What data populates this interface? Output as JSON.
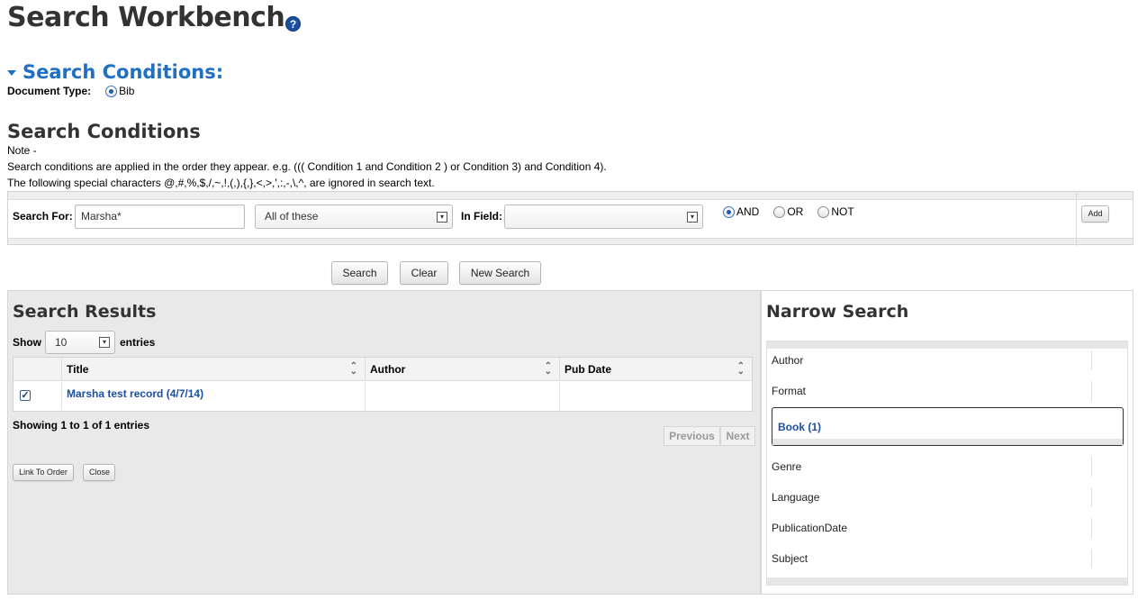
{
  "header": {
    "title": "Search Workbench",
    "help_glyph": "?"
  },
  "section": {
    "title": "Search Conditions:"
  },
  "document_type": {
    "label": "Document Type:",
    "option": "Bib"
  },
  "conditions": {
    "heading": "Search Conditions",
    "note_label": "Note -",
    "note_line1": "Search conditions are applied in the order they appear. e.g. ((( Condition 1 and Condition 2 ) or Condition 3) and Condition 4).",
    "note_line2": "The following special characters @,#,%,$,/,~,!,(,),{,},<,>,',:,-,\\,^, are ignored in search text.",
    "search_for_label": "Search For:",
    "search_for_value": "Marsha*",
    "match_select": "All of these",
    "in_field_label": "In Field:",
    "in_field_value": "",
    "operators": [
      "AND",
      "OR",
      "NOT"
    ],
    "selected_operator": "AND",
    "add_label": "Add"
  },
  "actions": {
    "search": "Search",
    "clear": "Clear",
    "new_search": "New Search"
  },
  "results": {
    "title": "Search Results",
    "show_label": "Show",
    "page_size": "10",
    "entries_label": "entries",
    "columns": [
      "Title",
      "Author",
      "Pub Date"
    ],
    "rows": [
      {
        "checked": true,
        "title": "Marsha test record (4/7/14)",
        "author": "",
        "pub_date": ""
      }
    ],
    "summary": "Showing 1 to 1 of 1 entries",
    "previous": "Previous",
    "next": "Next",
    "link_to_order": "Link To Order",
    "close": "Close"
  },
  "narrow": {
    "title": "Narrow Search",
    "facets": [
      "Author",
      "Format",
      "Genre",
      "Language",
      "PublicationDate",
      "Subject"
    ],
    "selected_facet_value": "Book (1)"
  },
  "colors": {
    "link_blue": "#1c4fa3",
    "section_blue": "#1f6fc5",
    "panel_gray": "#e9e9e9"
  },
  "icons": {
    "help": "help-icon",
    "collapse": "triangle-down-icon",
    "sort": "sort-icon",
    "dropdown": "chevron-down-icon"
  }
}
